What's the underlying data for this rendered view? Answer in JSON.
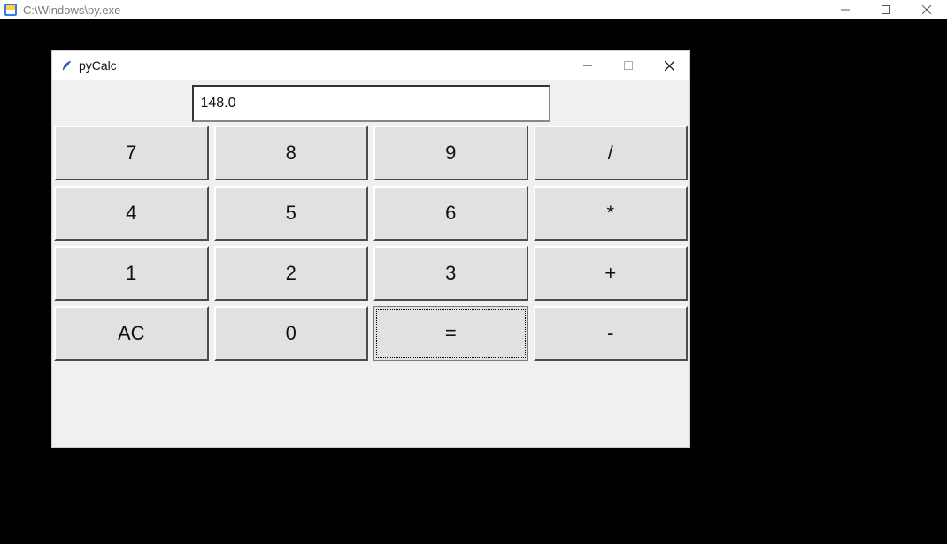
{
  "outer_window": {
    "title": "C:\\Windows\\py.exe"
  },
  "inner_window": {
    "title": "pyCalc"
  },
  "calculator": {
    "display_value": "148.0",
    "buttons": {
      "r0c0": "7",
      "r0c1": "8",
      "r0c2": "9",
      "r0c3": "/",
      "r1c0": "4",
      "r1c1": "5",
      "r1c2": "6",
      "r1c3": "*",
      "r2c0": "1",
      "r2c1": "2",
      "r2c2": "3",
      "r2c3": "+",
      "r3c0": "AC",
      "r3c1": "0",
      "r3c2": "=",
      "r3c3": "-"
    },
    "focused_button": "r3c2"
  }
}
